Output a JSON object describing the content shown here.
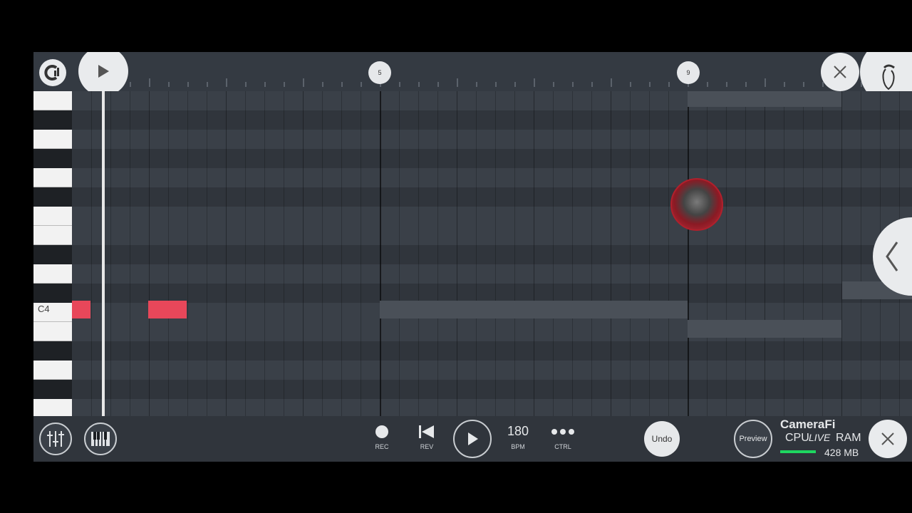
{
  "timeline": {
    "bar_markers": [
      "5",
      "9"
    ]
  },
  "keyboard": {
    "c4_label": "C4"
  },
  "transport": {
    "rec_label": "REC",
    "rev_label": "REV",
    "bpm_value": "180",
    "bpm_label": "BPM",
    "ctrl_label": "CTRL",
    "undo_label": "Undo",
    "preview_label": "Preview"
  },
  "system": {
    "cpu_label": "CPU",
    "ram_label": "RAM",
    "ram_value": "428 MB",
    "overlay_brand": "CameraFi",
    "overlay_live": "LIVE"
  },
  "colors": {
    "note": "#e8475a",
    "accent_green": "#1ed760"
  },
  "icons": {
    "logo": "fl-logo-icon",
    "play": "play-icon",
    "close": "close-icon",
    "fruit": "fl-fruit-icon",
    "mixer": "mixer-icon",
    "piano": "piano-icon",
    "record": "record-icon",
    "rewind": "rewind-icon",
    "more": "more-dots-icon",
    "back": "chevron-left-icon"
  }
}
